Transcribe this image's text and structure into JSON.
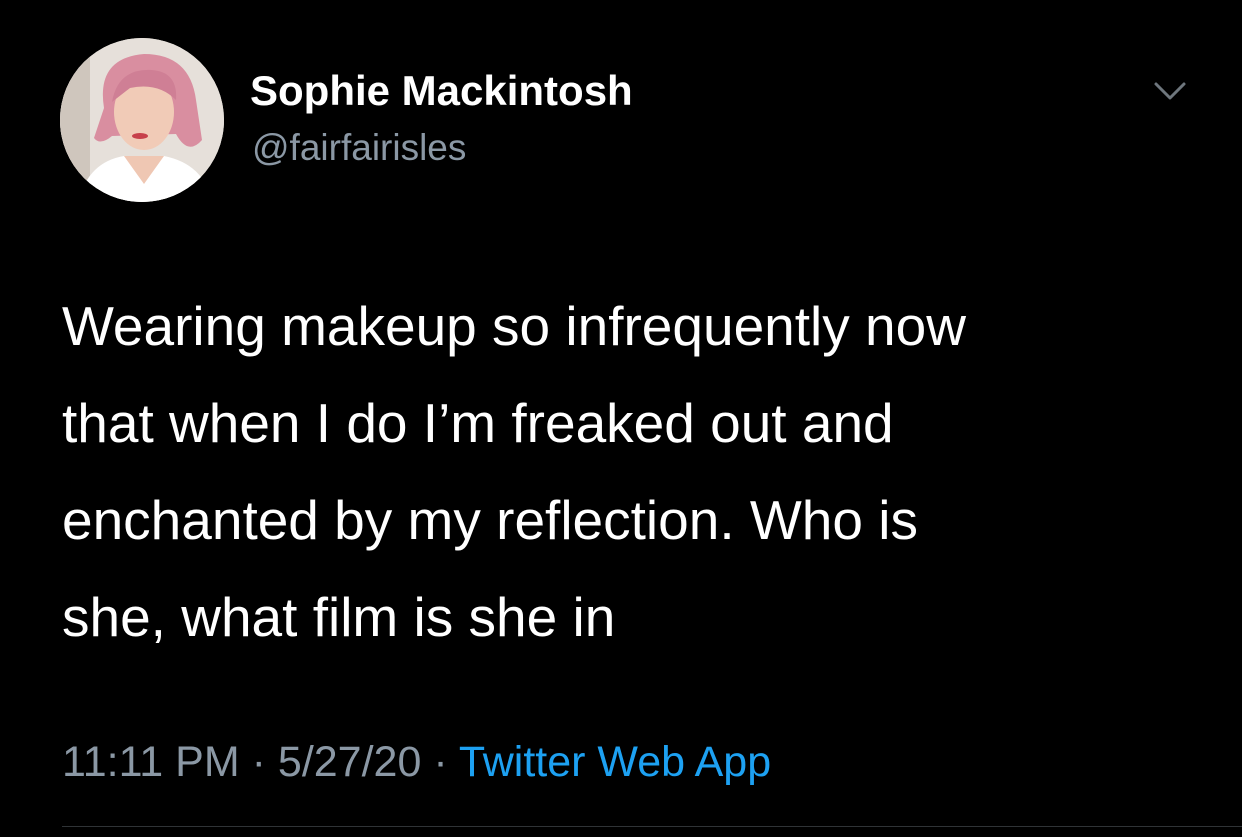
{
  "tweet": {
    "author": {
      "display_name": "Sophie Mackintosh",
      "handle": "@fairfairisles",
      "avatar_icon": "profile-photo"
    },
    "text": "Wearing makeup so infrequently now\nthat when I do I’m freaked out and\nenchanted by my reflection. Who is\nshe, what film is she in",
    "time": "11:11 PM",
    "date": "5/27/20",
    "separator": "·",
    "source": "Twitter Web App",
    "menu_icon": "chevron-down-icon"
  },
  "colors": {
    "background": "#000000",
    "text_primary": "#ffffff",
    "text_secondary": "#8b98a5",
    "link": "#1da1f2"
  }
}
